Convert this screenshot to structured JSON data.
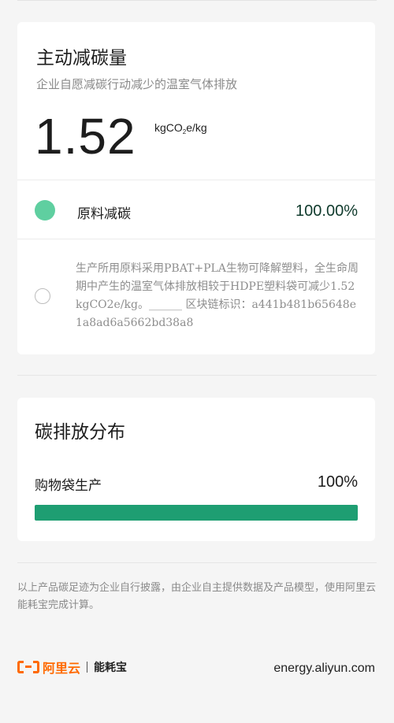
{
  "reduction_card": {
    "title": "主动减碳量",
    "subtitle": "企业自愿减碳行动减少的温室气体排放",
    "value": "1.52",
    "unit_prefix": "kgCO",
    "unit_sub": "2",
    "unit_suffix": "e/kg",
    "item": {
      "label": "原料减碳",
      "value": "100.00%",
      "dot_color": "#5fcfa0",
      "description": "生产所用原料采用PBAT+PLA生物可降解塑料，全生命周期中产生的温室气体排放相较于HDPE塑料袋可减少1.52kgCO2e/kg。______ 区块链标识：a441b481b65648e1a8ad6a5662bd38a8"
    }
  },
  "distribution_card": {
    "title": "碳排放分布",
    "bar": {
      "label": "购物袋生产",
      "value_text": "100%",
      "fraction": 1.0,
      "color": "#1e9e72"
    }
  },
  "footer": {
    "note": "以上产品碳足迹为企业自行披露，由企业自主提供数据及产品模型，使用阿里云能耗宝完成计算。",
    "logo_brand": "阿里云",
    "logo_product": "能耗宝",
    "site": "energy.aliyun.com",
    "brand_color": "#ff6a00"
  }
}
